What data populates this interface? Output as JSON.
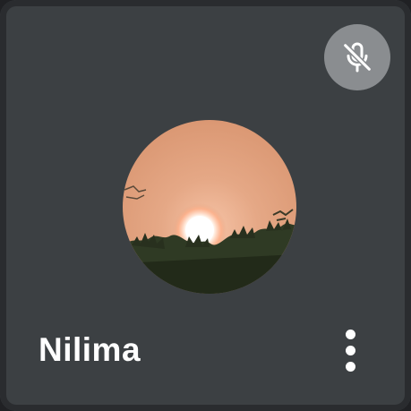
{
  "participant": {
    "name": "Nilima",
    "mic_status_icon": "mic-off-icon",
    "menu_icon": "more-vert-icon",
    "avatar_icon": "sunset-photo"
  },
  "colors": {
    "tile_background": "#3c4043",
    "mic_badge": "#8a8d90",
    "name_text": "#ffffff"
  }
}
